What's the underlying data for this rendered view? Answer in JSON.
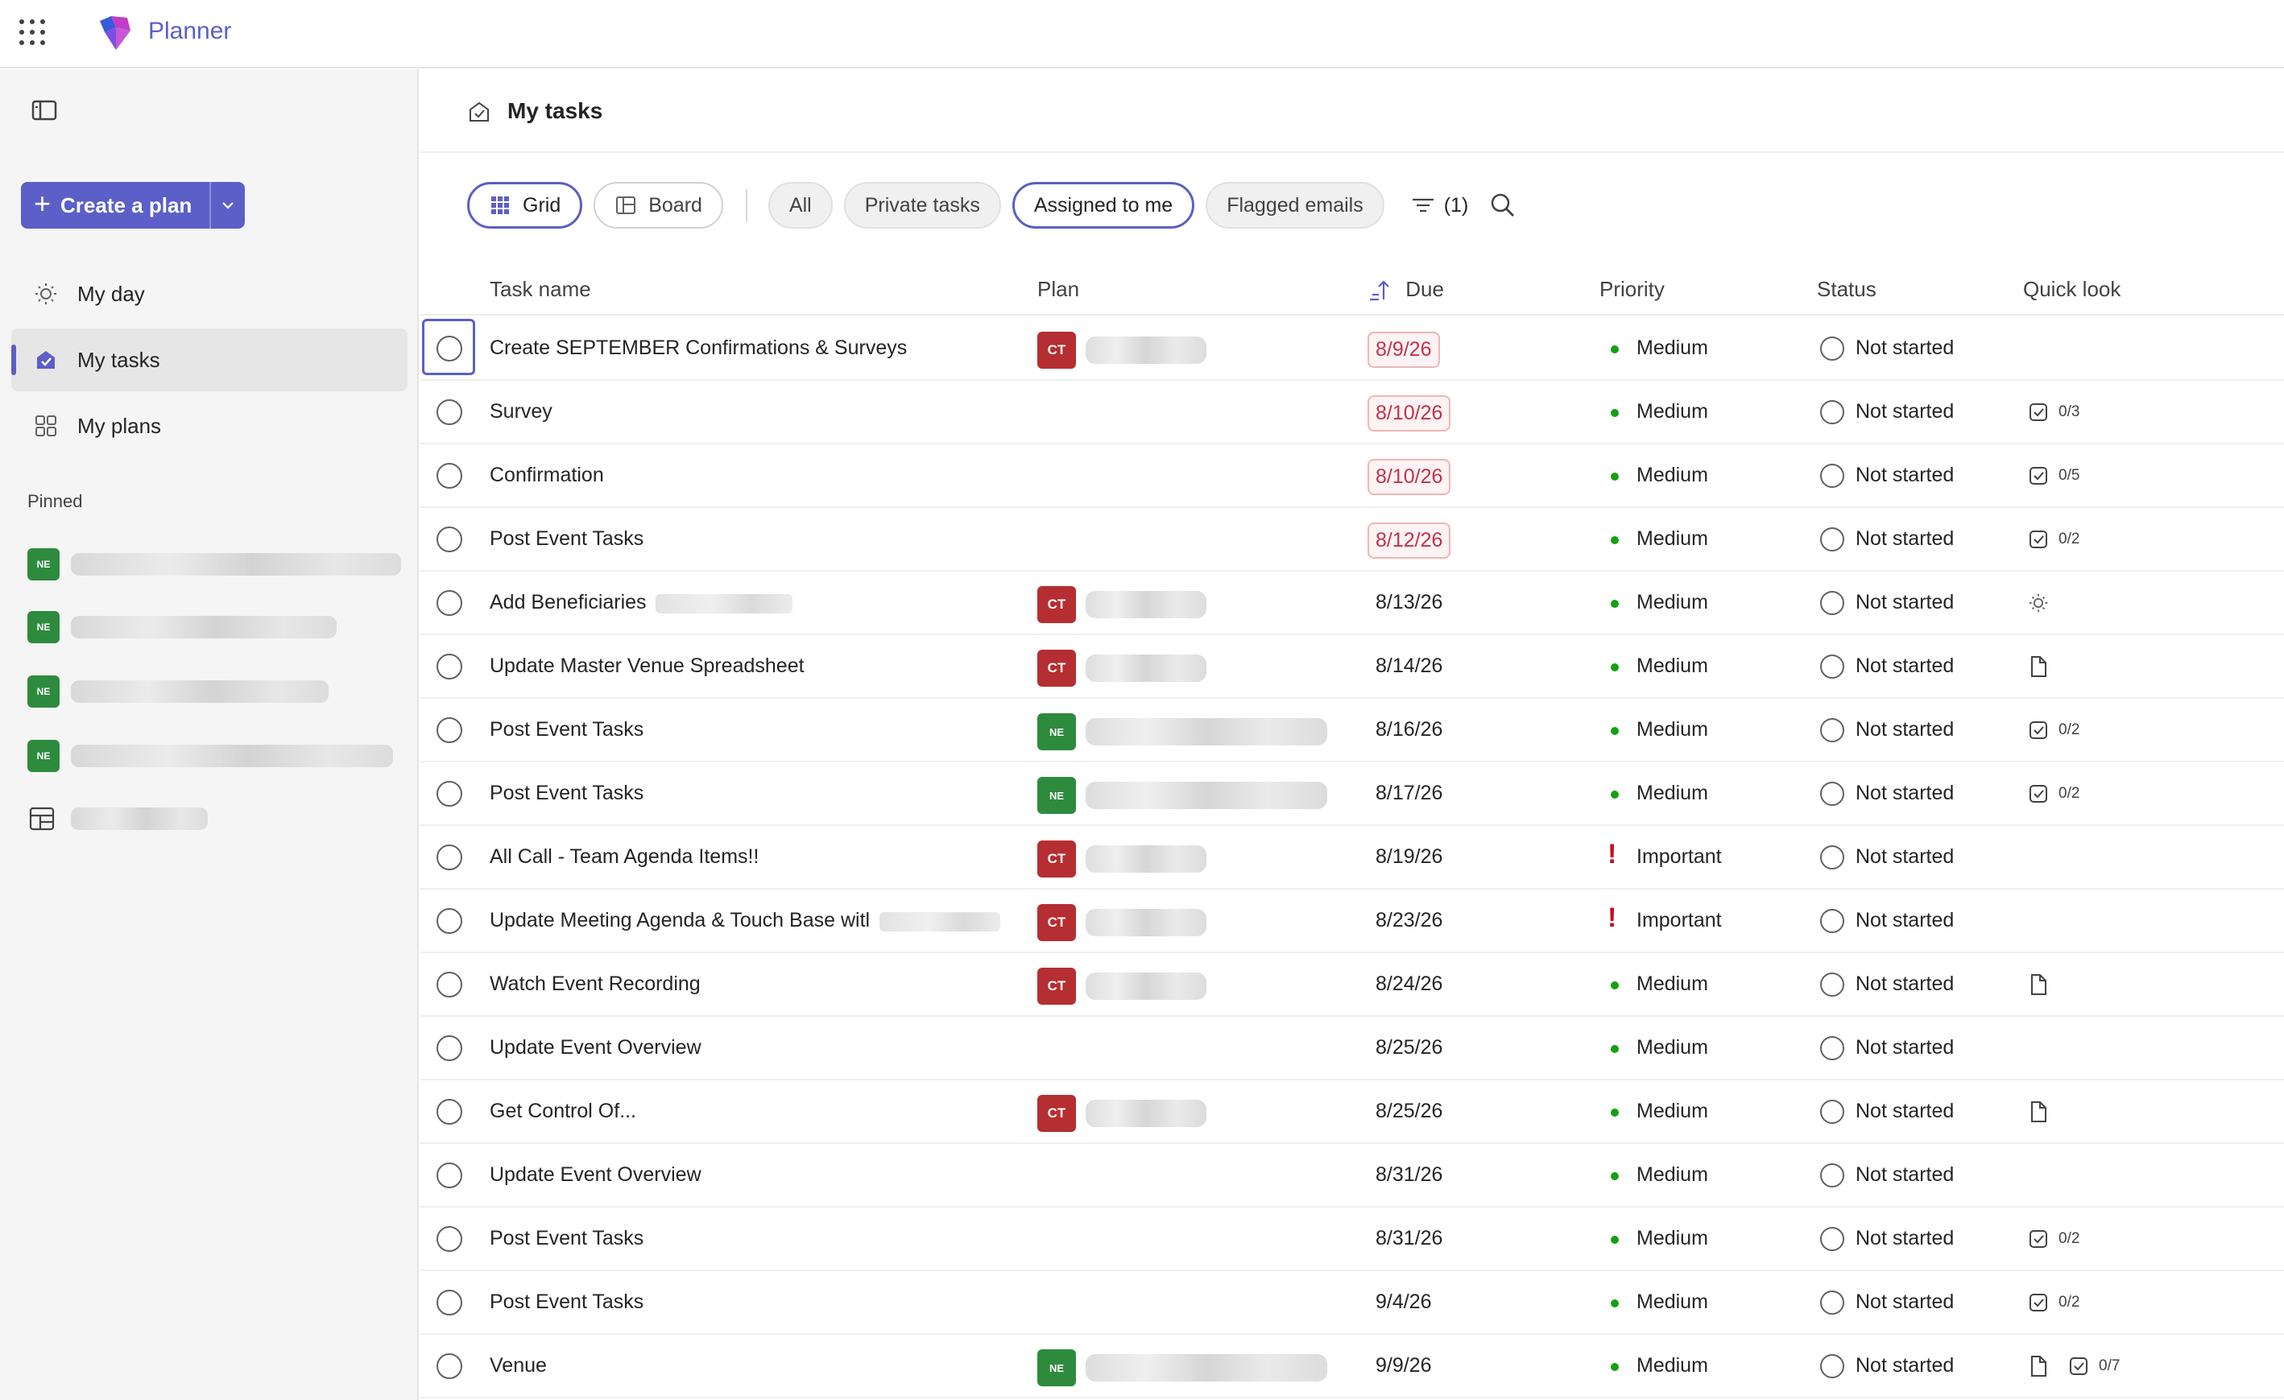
{
  "app": {
    "name": "Planner",
    "brand_color": "#5b5fc7",
    "icons": {
      "waffle": "app-launcher-icon",
      "logo": "planner-logo-icon"
    }
  },
  "sidebar": {
    "create_label": "Create a plan",
    "nav": [
      {
        "label": "My day",
        "icon": "sun-icon",
        "active": false
      },
      {
        "label": "My tasks",
        "icon": "tasks-icon",
        "active": true
      },
      {
        "label": "My plans",
        "icon": "grid-icon",
        "active": false
      }
    ],
    "pinned_label": "Pinned",
    "pinned": [
      {
        "avatar": "NE"
      },
      {
        "avatar": "NE"
      },
      {
        "avatar": "NE"
      },
      {
        "avatar": "NE"
      },
      {
        "avatar": ""
      }
    ]
  },
  "main": {
    "title": "My tasks",
    "views": [
      {
        "label": "Grid",
        "selected": true
      },
      {
        "label": "Board",
        "selected": false
      }
    ],
    "filters": [
      {
        "label": "All",
        "selected": false
      },
      {
        "label": "Private tasks",
        "selected": false
      },
      {
        "label": "Assigned to me",
        "selected": true
      },
      {
        "label": "Flagged emails",
        "selected": false
      }
    ],
    "filter_count": "(1)",
    "columns": {
      "task": "Task name",
      "plan": "Plan",
      "due": "Due",
      "priority": "Priority",
      "status": "Status",
      "quick": "Quick look"
    },
    "tasks": [
      {
        "name": "Create SEPTEMBER Confirmations & Surveys",
        "plan": "CT",
        "due": "8/9/26",
        "overdue": true,
        "priority": "Medium",
        "status": "Not started",
        "quick": []
      },
      {
        "name": "Survey",
        "plan": "",
        "due": "8/10/26",
        "overdue": true,
        "priority": "Medium",
        "status": "Not started",
        "quick": [
          {
            "icon": "checklist-icon",
            "text": "0/3"
          }
        ]
      },
      {
        "name": "Confirmation",
        "plan": "",
        "due": "8/10/26",
        "overdue": true,
        "priority": "Medium",
        "status": "Not started",
        "quick": [
          {
            "icon": "checklist-icon",
            "text": "0/5"
          }
        ]
      },
      {
        "name": "Post Event Tasks",
        "plan": "",
        "due": "8/12/26",
        "overdue": true,
        "priority": "Medium",
        "status": "Not started",
        "quick": [
          {
            "icon": "checklist-icon",
            "text": "0/2"
          }
        ]
      },
      {
        "name": "Add Beneficiaries",
        "plan": "CT",
        "due": "8/13/26",
        "overdue": false,
        "priority": "Medium",
        "status": "Not started",
        "quick": [
          {
            "icon": "sun-icon",
            "text": ""
          }
        ]
      },
      {
        "name": "Update Master Venue Spreadsheet",
        "plan": "CT",
        "due": "8/14/26",
        "overdue": false,
        "priority": "Medium",
        "status": "Not started",
        "quick": [
          {
            "icon": "file-icon",
            "text": ""
          }
        ]
      },
      {
        "name": "Post Event Tasks",
        "plan": "NE",
        "due": "8/16/26",
        "overdue": false,
        "priority": "Medium",
        "status": "Not started",
        "quick": [
          {
            "icon": "checklist-icon",
            "text": "0/2"
          }
        ]
      },
      {
        "name": "Post Event Tasks",
        "plan": "NE",
        "due": "8/17/26",
        "overdue": false,
        "priority": "Medium",
        "status": "Not started",
        "quick": [
          {
            "icon": "checklist-icon",
            "text": "0/2"
          }
        ]
      },
      {
        "name": "All Call - Team Agenda Items!!",
        "plan": "CT",
        "due": "8/19/26",
        "overdue": false,
        "priority": "Important",
        "status": "Not started",
        "quick": []
      },
      {
        "name": "Update Meeting Agenda & Touch Base witl",
        "plan": "CT",
        "due": "8/23/26",
        "overdue": false,
        "priority": "Important",
        "status": "Not started",
        "quick": []
      },
      {
        "name": "Watch Event Recording",
        "plan": "CT",
        "due": "8/24/26",
        "overdue": false,
        "priority": "Medium",
        "status": "Not started",
        "quick": [
          {
            "icon": "file-icon",
            "text": ""
          }
        ]
      },
      {
        "name": "Update Event Overview",
        "plan": "",
        "due": "8/25/26",
        "overdue": false,
        "priority": "Medium",
        "status": "Not started",
        "quick": []
      },
      {
        "name": "Get Control Of...",
        "plan": "CT",
        "due": "8/25/26",
        "overdue": false,
        "priority": "Medium",
        "status": "Not started",
        "quick": [
          {
            "icon": "file-icon",
            "text": ""
          }
        ]
      },
      {
        "name": "Update Event Overview",
        "plan": "",
        "due": "8/31/26",
        "overdue": false,
        "priority": "Medium",
        "status": "Not started",
        "quick": []
      },
      {
        "name": "Post Event Tasks",
        "plan": "",
        "due": "8/31/26",
        "overdue": false,
        "priority": "Medium",
        "status": "Not started",
        "quick": [
          {
            "icon": "checklist-icon",
            "text": "0/2"
          }
        ]
      },
      {
        "name": "Post Event Tasks",
        "plan": "",
        "due": "9/4/26",
        "overdue": false,
        "priority": "Medium",
        "status": "Not started",
        "quick": [
          {
            "icon": "checklist-icon",
            "text": "0/2"
          }
        ]
      },
      {
        "name": "Venue",
        "plan": "NE",
        "due": "9/9/26",
        "overdue": false,
        "priority": "Medium",
        "status": "Not started",
        "quick": [
          {
            "icon": "file-icon",
            "text": ""
          },
          {
            "icon": "checklist-icon",
            "text": "0/7"
          }
        ]
      }
    ]
  }
}
